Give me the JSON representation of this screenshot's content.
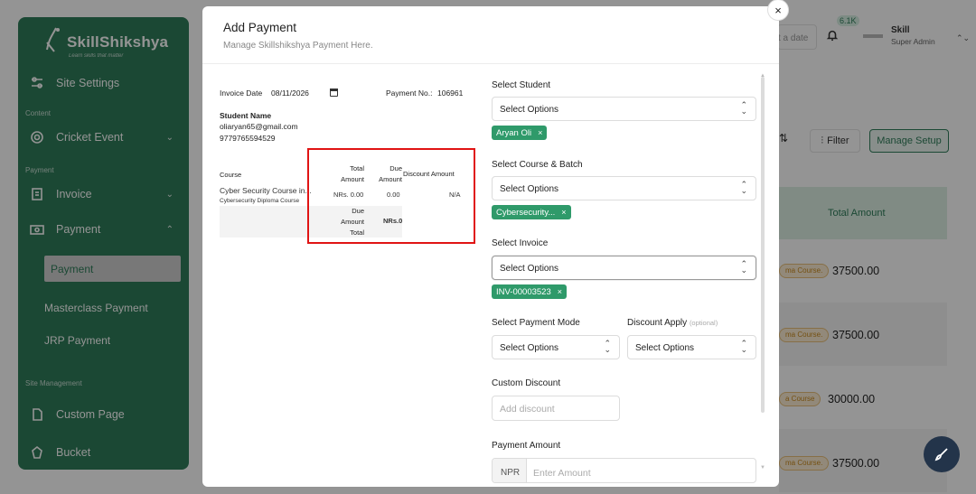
{
  "sidebar": {
    "brand_name": "SkillShikshya",
    "brand_tagline": "Learn skills that matter",
    "items": {
      "site_settings": "Site Settings",
      "content_section": "Content",
      "cricket_event": "Cricket Event",
      "payment_section": "Payment",
      "invoice": "Invoice",
      "payment": "Payment",
      "payment_sub": "Payment",
      "masterclass_payment": "Masterclass Payment",
      "jrp_payment": "JRP Payment",
      "site_management_section": "Site Management",
      "custom_page": "Custom Page",
      "bucket": "Bucket"
    }
  },
  "topbar": {
    "date_placeholder": "t a date",
    "notification_count": "6.1K",
    "user_name": "Skill",
    "user_role": "Super Admin"
  },
  "background": {
    "filter_label": "Filter",
    "manage_setup_label": "Manage Setup",
    "total_amount_header": "Total Amount",
    "rows": [
      {
        "badge": "ma Course.",
        "amount": "37500.00"
      },
      {
        "badge": "ma Course.",
        "amount": "37500.00"
      },
      {
        "badge": "a Course",
        "amount": "30000.00"
      },
      {
        "badge": "ma Course.",
        "amount": "37500.00"
      }
    ]
  },
  "modal": {
    "title": "Add Payment",
    "subtitle": "Manage Skillshikshya Payment Here.",
    "close_glyph": "×"
  },
  "invoice_preview": {
    "invoice_date_label": "Invoice Date",
    "invoice_date_value": "08/11/2026",
    "payment_no_label": "Payment No.:",
    "payment_no_value": "106961",
    "student_name_label": "Student Name",
    "student_email": "oliaryan65@gmail.com",
    "student_phone": "9779765594529",
    "table": {
      "col_course": "Course",
      "col_total_amount_1": "Total",
      "col_total_amount_2": "Amount",
      "col_due_amount_1": "Due",
      "col_due_amount_2": "Amount",
      "col_discount_amount": "Discount Amount",
      "course_name": "Cyber Security Course in...",
      "course_sub": "Cybersecurity Diploma Course",
      "total_amount": "NRs. 0.00",
      "due_amount": "0.00",
      "discount_amount": "N/A",
      "due_total_label_1": "Due",
      "due_total_label_2": "Amount",
      "due_total_label_3": "Total",
      "due_total_value": "NRs.0"
    }
  },
  "form": {
    "select_student_label": "Select Student",
    "select_student_placeholder": "Select Options",
    "student_tag": "Aryan Oli",
    "select_course_label": "Select Course & Batch",
    "select_course_placeholder": "Select Options",
    "course_tag": "Cybersecurity...",
    "select_invoice_label": "Select Invoice",
    "select_invoice_placeholder": "Select Options",
    "invoice_tag": "INV-00003523",
    "payment_mode_label": "Select Payment Mode",
    "payment_mode_placeholder": "Select Options",
    "discount_apply_label": "Discount Apply",
    "discount_apply_optional": "(optional)",
    "discount_apply_placeholder": "Select Options",
    "custom_discount_label": "Custom Discount",
    "custom_discount_placeholder": "Add discount",
    "payment_amount_label": "Payment Amount",
    "currency_prefix": "NPR",
    "payment_amount_placeholder": "Enter Amount",
    "tag_remove_glyph": "×",
    "chevron_glyph": "⌃⌄"
  }
}
